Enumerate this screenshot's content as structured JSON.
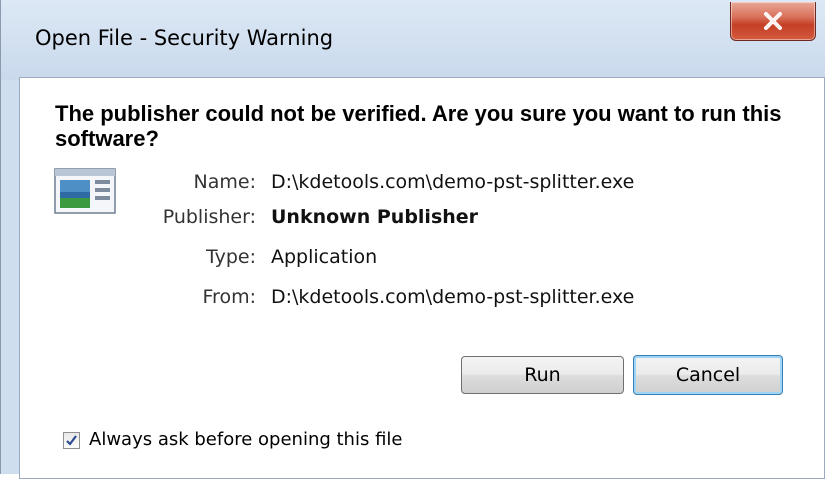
{
  "window": {
    "title": "Open File - Security Warning",
    "close_icon": "close-icon"
  },
  "dialog": {
    "headline": "The publisher could not be verified.  Are you sure you want to run this software?",
    "icon": "application-icon",
    "fields": {
      "name_label": "Name:",
      "name_value": "D:\\kdetools.com\\demo-pst-splitter.exe",
      "publisher_label": "Publisher:",
      "publisher_value": "Unknown Publisher",
      "type_label": "Type:",
      "type_value": "Application",
      "from_label": "From:",
      "from_value": "D:\\kdetools.com\\demo-pst-splitter.exe"
    },
    "buttons": {
      "run_label": "Run",
      "cancel_label": "Cancel"
    },
    "always_ask": {
      "label": "Always ask before opening this file",
      "checked": true
    }
  },
  "colors": {
    "close_button": "#c43f25",
    "frame": "#cfdeee",
    "focus_ring": "#3c7fb1"
  }
}
